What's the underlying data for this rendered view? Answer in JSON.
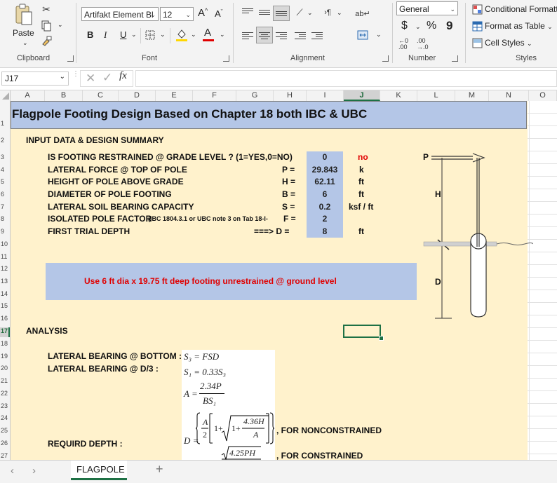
{
  "ribbon": {
    "clipboard": {
      "paste": "Paste",
      "label": "Clipboard"
    },
    "font": {
      "family": "Artifakt Element Bl",
      "size": "12",
      "grow": "A",
      "shrink": "A",
      "bold": "B",
      "italic": "I",
      "underline": "U",
      "fontcolor": "A",
      "label": "Font"
    },
    "alignment": {
      "label": "Alignment"
    },
    "number": {
      "format": "General",
      "currency": "$",
      "percent": "%",
      "comma": "9",
      "inc_dec": ".00→.0",
      "label": "Number"
    },
    "styles": {
      "conditional": "Conditional Formatt",
      "table": "Format as Table",
      "cell": "Cell Styles",
      "label": "Styles"
    }
  },
  "formula_bar": {
    "name_box": "J17",
    "fx": "fx",
    "value": ""
  },
  "columns": [
    "A",
    "B",
    "C",
    "D",
    "E",
    "F",
    "G",
    "H",
    "I",
    "J",
    "K",
    "L",
    "M",
    "N",
    "O"
  ],
  "rows": [
    "1",
    "2",
    "3",
    "4",
    "5",
    "6",
    "7",
    "8",
    "9",
    "10",
    "11",
    "12",
    "13",
    "14",
    "15",
    "16",
    "17",
    "18",
    "19",
    "20",
    "21",
    "22",
    "23",
    "24",
    "25",
    "26",
    "27"
  ],
  "sheet": {
    "title": "Flagpole Footing Design Based on Chapter 18 both IBC & UBC",
    "section_input": "INPUT DATA & DESIGN SUMMARY",
    "inputs": [
      {
        "label": "IS FOOTING RESTRAINED @ GRADE LEVEL ?  (1=YES,0=NO)",
        "sym": "",
        "value": "0",
        "unit": "no"
      },
      {
        "label": "LATERAL FORCE @ TOP OF POLE",
        "sym": "P =",
        "value": "29.843",
        "unit": "k"
      },
      {
        "label": "HEIGHT OF POLE ABOVE GRADE",
        "sym": "H =",
        "value": "62.11",
        "unit": "ft"
      },
      {
        "label": "DIAMETER OF POLE FOOTING",
        "sym": "B =",
        "value": "6",
        "unit": "ft"
      },
      {
        "label": "LATERAL SOIL BEARING CAPACITY",
        "sym": "S =",
        "value": "0.2",
        "unit": "ksf / ft"
      },
      {
        "label": "ISOLATED POLE FACTOR",
        "note": "(IBC 1804.3.1 or UBC note 3 on Tab 18-I-",
        "sym": "F =",
        "value": "2",
        "unit": ""
      },
      {
        "label": "FIRST TRIAL DEPTH",
        "sym": "===>  D =",
        "value": "8",
        "unit": "ft"
      }
    ],
    "result": "Use  6 ft dia x 19.75 ft  deep   footing unrestrained @ ground level",
    "section_analysis": "ANALYSIS",
    "analysis": {
      "bottom": "LATERAL BEARING @ BOTTOM :",
      "d3": "LATERAL BEARING @ D/3 :",
      "depth": "REQUIRD DEPTH :",
      "nonconstrained": ", FOR NONCONSTRAINED",
      "constrained": ", FOR CONSTRAINED"
    },
    "equations": {
      "s3": "S₃ = FSD",
      "s1": "S₁ = 0.33S₃",
      "a_lhs": "A =",
      "a_num": "2.34P",
      "a_den": "BS₁",
      "d_lhs": "D =",
      "d_a": "A",
      "d_two": "2",
      "d_one": "1+",
      "d_inner": "1+",
      "d_num": "4.36H",
      "d_den": "A",
      "d2_num": "4.25PH"
    },
    "diagram": {
      "p": "P",
      "h": "H",
      "d": "D"
    }
  },
  "sheet_tabs": {
    "active": "FLAGPOLE",
    "add": "+"
  }
}
